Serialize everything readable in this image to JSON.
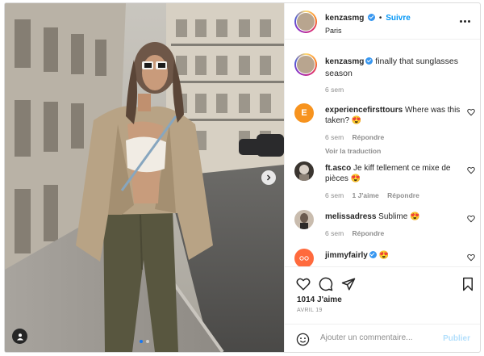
{
  "post": {
    "author": "kenzasmg",
    "follow_label": "Suivre",
    "separator": "•",
    "location": "Paris",
    "caption": "finally that sunglasses season",
    "caption_time": "6 sem",
    "likes": "1014 J'aime",
    "date": "AVRIL 19"
  },
  "comments": [
    {
      "user": "experiencefirsttours",
      "text": "Where was this taken? 😍",
      "time": "6 sem",
      "likes": "",
      "reply_label": "Répondre",
      "translate_label": "Voir la traduction",
      "avatar_letter": "E",
      "avatar_color": "#f7931e"
    },
    {
      "user": "ft.asco",
      "text": "Je kiff tellement ce mixe de pièces 😍",
      "time": "6 sem",
      "likes": "1 J'aime",
      "reply_label": "Répondre",
      "avatar_color": "#3a3530"
    },
    {
      "user": "melissadress",
      "text": "Sublime 😍",
      "time": "6 sem",
      "likes": "",
      "reply_label": "Répondre",
      "avatar_color": "#6b5a4e"
    },
    {
      "user": "jimmyfairly",
      "text": "😍",
      "time": "",
      "likes": "",
      "reply_label": "",
      "avatar_color": "#ff6a3d"
    }
  ],
  "compose": {
    "placeholder": "Ajouter un commentaire...",
    "publish_label": "Publier"
  },
  "icons": {
    "like": "heart-icon",
    "comment": "comment-bubble-icon",
    "share": "paper-plane-icon",
    "save": "bookmark-icon",
    "more": "more-dots-icon",
    "next": "chevron-right-icon",
    "tag": "user-tag-icon",
    "emoji": "emoji-icon"
  },
  "colors": {
    "accent": "#0095f6",
    "verified": "#3897f0",
    "active_dot": "#1877f2",
    "publish_disabled": "#b2dffc"
  },
  "carousel": {
    "slides": 2,
    "active": 1
  }
}
